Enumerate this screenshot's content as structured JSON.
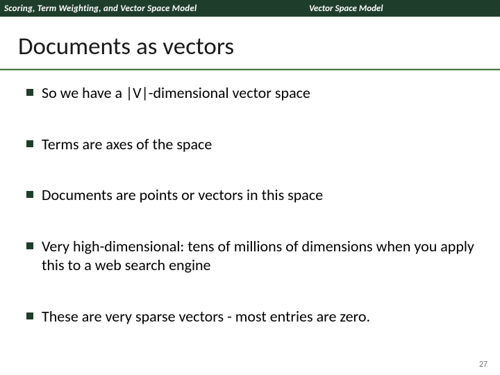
{
  "header": {
    "left": "Scoring, Term Weighting, and Vector Space Model",
    "right": "Vector Space Model"
  },
  "title": "Documents as vectors",
  "bullets": [
    "So we have a |V|-dimensional vector space",
    "Terms are axes of the space",
    "Documents are points or vectors in this space",
    "Very high-dimensional: tens of millions of dimensions when you apply this to a web search engine",
    "These are very sparse vectors - most entries are zero."
  ],
  "slide_number": "27"
}
